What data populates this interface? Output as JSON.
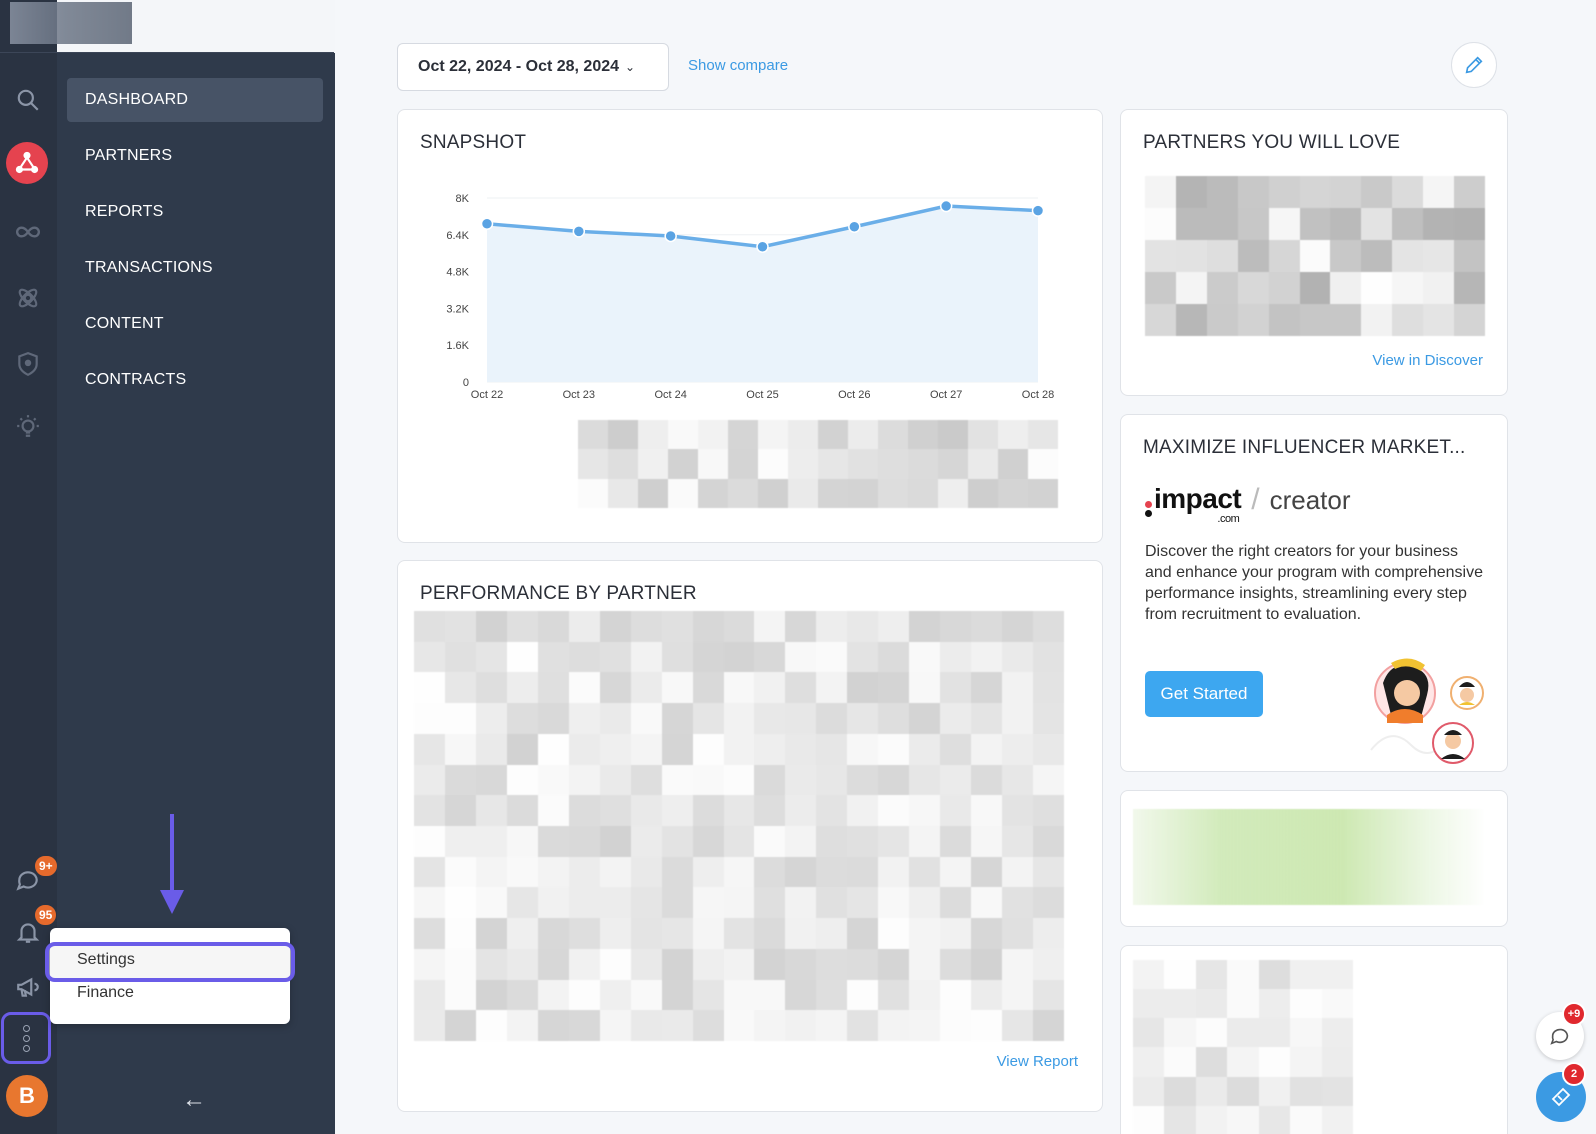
{
  "sidebar": {
    "nav_items": [
      {
        "label": "DASHBOARD",
        "active": true
      },
      {
        "label": "PARTNERS",
        "active": false
      },
      {
        "label": "REPORTS",
        "active": false
      },
      {
        "label": "TRANSACTIONS",
        "active": false
      },
      {
        "label": "CONTENT",
        "active": false
      },
      {
        "label": "CONTRACTS",
        "active": false
      }
    ],
    "rail_icons": [
      "search-icon",
      "network-icon",
      "infinity-icon",
      "atom-icon",
      "shield-icon",
      "lightbulb-icon",
      "chat-icon",
      "bell-icon",
      "megaphone-icon",
      "more-options-icon"
    ],
    "chat_badge": "9+",
    "bell_badge": "95",
    "avatar_initial": "B",
    "collapse_arrow": "←",
    "menu": {
      "settings": "Settings",
      "finance": "Finance"
    }
  },
  "header": {
    "date_range": "Oct 22, 2024 - Oct 28, 2024",
    "date_chevron": "⌄",
    "show_compare": "Show compare"
  },
  "snapshot": {
    "title": "SNAPSHOT"
  },
  "chart_data": {
    "type": "area",
    "title": "",
    "categories": [
      "Oct 22",
      "Oct 23",
      "Oct 24",
      "Oct 25",
      "Oct 26",
      "Oct 27",
      "Oct 28"
    ],
    "series": [
      {
        "values": [
          6880,
          6550,
          6350,
          5880,
          6750,
          7650,
          7450
        ]
      }
    ],
    "y_ticks": [
      "0",
      "1.6K",
      "3.2K",
      "4.8K",
      "6.4K",
      "8K"
    ],
    "ylim": [
      0,
      8000
    ],
    "grid": true,
    "colors": {
      "line": "#6aaee8",
      "fill": "#eaf3fb",
      "point": "#5aa3e3"
    }
  },
  "partners_love": {
    "title": "PARTNERS YOU WILL LOVE",
    "link": "View in Discover"
  },
  "promo": {
    "title": "MAXIMIZE INFLUENCER MARKET...",
    "brand": "impact",
    "brand_suffix": ".com",
    "slash": "/",
    "product": "creator",
    "description": "Discover the right creators for your business and enhance your program with comprehensive performance insights, streamlining every step from recruitment to evaluation.",
    "cta": "Get Started"
  },
  "performance": {
    "title": "PERFORMANCE BY PARTNER",
    "link": "View Report"
  },
  "fabs": {
    "chat_badge": "+9",
    "ticket_badge": "2"
  },
  "colors": {
    "accent": "#3b9ae3",
    "sidebar_rail": "#2a3342",
    "sidebar_nav": "#2f3a4b",
    "annotation": "#6a5ce8",
    "brand_red": "#e5434f",
    "badge_orange": "#e66a2c"
  }
}
